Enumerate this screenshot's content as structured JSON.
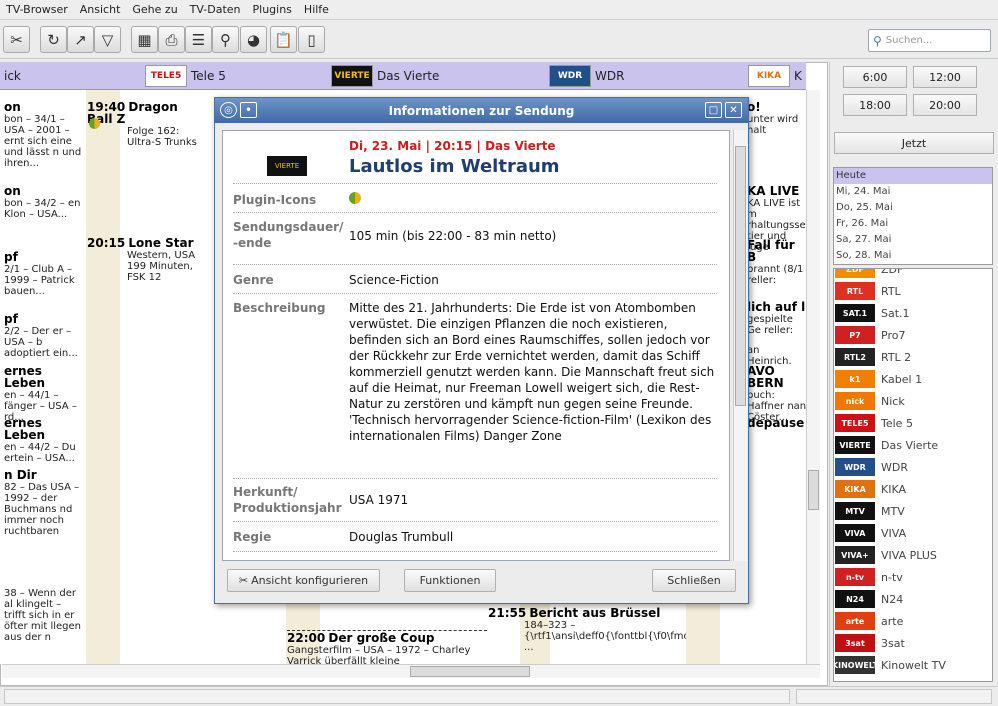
{
  "menu": [
    "TV-Browser",
    "Ansicht",
    "Gehe zu",
    "TV-Daten",
    "Plugins",
    "Hilfe"
  ],
  "search": {
    "placeholder": "Suchen..."
  },
  "channels_header": [
    {
      "name": "ick"
    },
    {
      "name": "Tele 5",
      "logo": "TELE5"
    },
    {
      "name": "Das Vierte",
      "logo": "VIERTE"
    },
    {
      "name": "WDR",
      "logo": "WDR"
    },
    {
      "name": "K",
      "logo": "KIKA"
    }
  ],
  "grid": {
    "col1": [
      {
        "title": "on",
        "desc": "bon – 34/1 – USA – 2001 – ernt sich eine und lässt n und ihren..."
      },
      {
        "title": "on",
        "desc": "bon – 34/2 – en Klon – USA..."
      },
      {
        "title": "pf",
        "desc": "2/1 – Club A – 1999 – Patrick bauen..."
      },
      {
        "title": "pf",
        "desc": "2/2 – Der er – USA – b adoptiert ein..."
      },
      {
        "title": "ernes Leben",
        "desc": "en – 44/1 – fänger – USA – rd..."
      },
      {
        "title": "ernes Leben",
        "desc": "en – 44/2 – Du ertein – USA..."
      },
      {
        "title": "n Dir",
        "desc": "82 – Das USA – 1992 – der Buchmans nd immer noch ruchtbaren"
      },
      {
        "title": "",
        "desc": "38 – Wenn der al klingelt – trifft sich in er öfter mit llegen aus der n"
      }
    ],
    "col2": [
      {
        "time": "19:40",
        "title": "Dragon Ball Z",
        "desc": "Folge 162: Ultra-S Trunks"
      },
      {
        "time": "20:15",
        "title": "Lone Star",
        "desc": "Western, USA 199 Minuten, FSK 12"
      }
    ],
    "col3": [
      {
        "time": "22:00",
        "title": "Der große Coup",
        "desc": "Gangsterfilm – USA – 1972 – Charley Varrick überfällt kleine"
      }
    ],
    "col4": [
      {
        "time": "21:55",
        "title": "Bericht aus Brüssel",
        "desc": "184–323 – {\\rtf1\\ansi\\deff0{\\fonttbl{\\f0\\fmodern ..."
      }
    ],
    "col5": [
      {
        "title": "o!",
        "desc": "unter wird halt"
      },
      {
        "title": "KA LIVE",
        "desc": "KA LIVE ist m rhaltungsse tier und Juge"
      },
      {
        "title": "Fall für B",
        "desc": "brannt (8/1 reller:"
      },
      {
        "title": "lich auf l",
        "desc": "gespielte Ge reller:"
      },
      {
        "title": "",
        "desc": "an Heinrich."
      },
      {
        "title": "AVO BERN",
        "desc": "buch: Haffner nan Cöster..."
      },
      {
        "title": "depause",
        "desc": ""
      }
    ]
  },
  "right": {
    "times": [
      "6:00",
      "12:00",
      "18:00",
      "20:00"
    ],
    "now": "Jetzt",
    "dates": [
      "Heute",
      "Mi, 24. Mai",
      "Do, 25. Mai",
      "Fr, 26. Mai",
      "Sa, 27. Mai",
      "So, 28. Mai"
    ],
    "channels": [
      {
        "name": "ZDF",
        "logo": "ZDF",
        "color": "#f28c00"
      },
      {
        "name": "RTL",
        "logo": "RTL",
        "color": "#e03020"
      },
      {
        "name": "Sat.1",
        "logo": "SAT.1",
        "color": "#111"
      },
      {
        "name": "Pro7",
        "logo": "P7",
        "color": "#d02020"
      },
      {
        "name": "RTL 2",
        "logo": "RTL2",
        "color": "#222"
      },
      {
        "name": "Kabel 1",
        "logo": "k1",
        "color": "#f08000"
      },
      {
        "name": "Nick",
        "logo": "nick",
        "color": "#f07800"
      },
      {
        "name": "Tele 5",
        "logo": "TELE5",
        "color": "#d01010"
      },
      {
        "name": "Das Vierte",
        "logo": "VIERTE",
        "color": "#111"
      },
      {
        "name": "WDR",
        "logo": "WDR",
        "color": "#20508a"
      },
      {
        "name": "KIKA",
        "logo": "KIKA",
        "color": "#e07010"
      },
      {
        "name": "MTV",
        "logo": "MTV",
        "color": "#111"
      },
      {
        "name": "VIVA",
        "logo": "VIVA",
        "color": "#111"
      },
      {
        "name": "VIVA PLUS",
        "logo": "VIVA+",
        "color": "#222"
      },
      {
        "name": "n-tv",
        "logo": "n-tv",
        "color": "#d02020"
      },
      {
        "name": "N24",
        "logo": "N24",
        "color": "#111"
      },
      {
        "name": "arte",
        "logo": "arte",
        "color": "#e04010"
      },
      {
        "name": "3sat",
        "logo": "3sat",
        "color": "#c01010"
      },
      {
        "name": "Kinowelt TV",
        "logo": "KINOWELT",
        "color": "#333"
      }
    ]
  },
  "dialog": {
    "title": "Informationen zur Sendung",
    "header_line": "Di, 23. Mai | 20:15 | Das Vierte",
    "program_title": "Lautlos im Weltraum",
    "rows": [
      {
        "label": "Plugin-Icons",
        "value": ""
      },
      {
        "label": "Sendungsdauer/ -ende",
        "value": "105 min (bis 22:00 - 83 min netto)"
      },
      {
        "label": "Genre",
        "value": "Science-Fiction"
      },
      {
        "label": "Beschreibung",
        "value": "Mitte des 21. Jahrhunderts: Die Erde ist von Atombomben verwüstet. Die einzigen Pflanzen die noch existieren, befinden sich an Bord eines Raumschiffes, sollen jedoch vor der Rückkehr zur Erde vernichtet werden, damit das Schiff kommerziell genutzt werden kann. Die Mannschaft freut sich auf die Heimat, nur Freeman Lowell weigert sich, die Rest-Natur zu zerstören und kämpft nun gegen seine Freunde. 'Technisch hervorragender Science-fiction-Film' (Lexikon des internationalen Films) Danger Zone"
      },
      {
        "label": "Herkunft/ Produktionsjahr",
        "value": "USA 1971"
      },
      {
        "label": "Regie",
        "value": "Douglas Trumbull"
      }
    ],
    "buttons": {
      "configure": "Ansicht konfigurieren",
      "functions": "Funktionen",
      "close": "Schließen"
    }
  }
}
